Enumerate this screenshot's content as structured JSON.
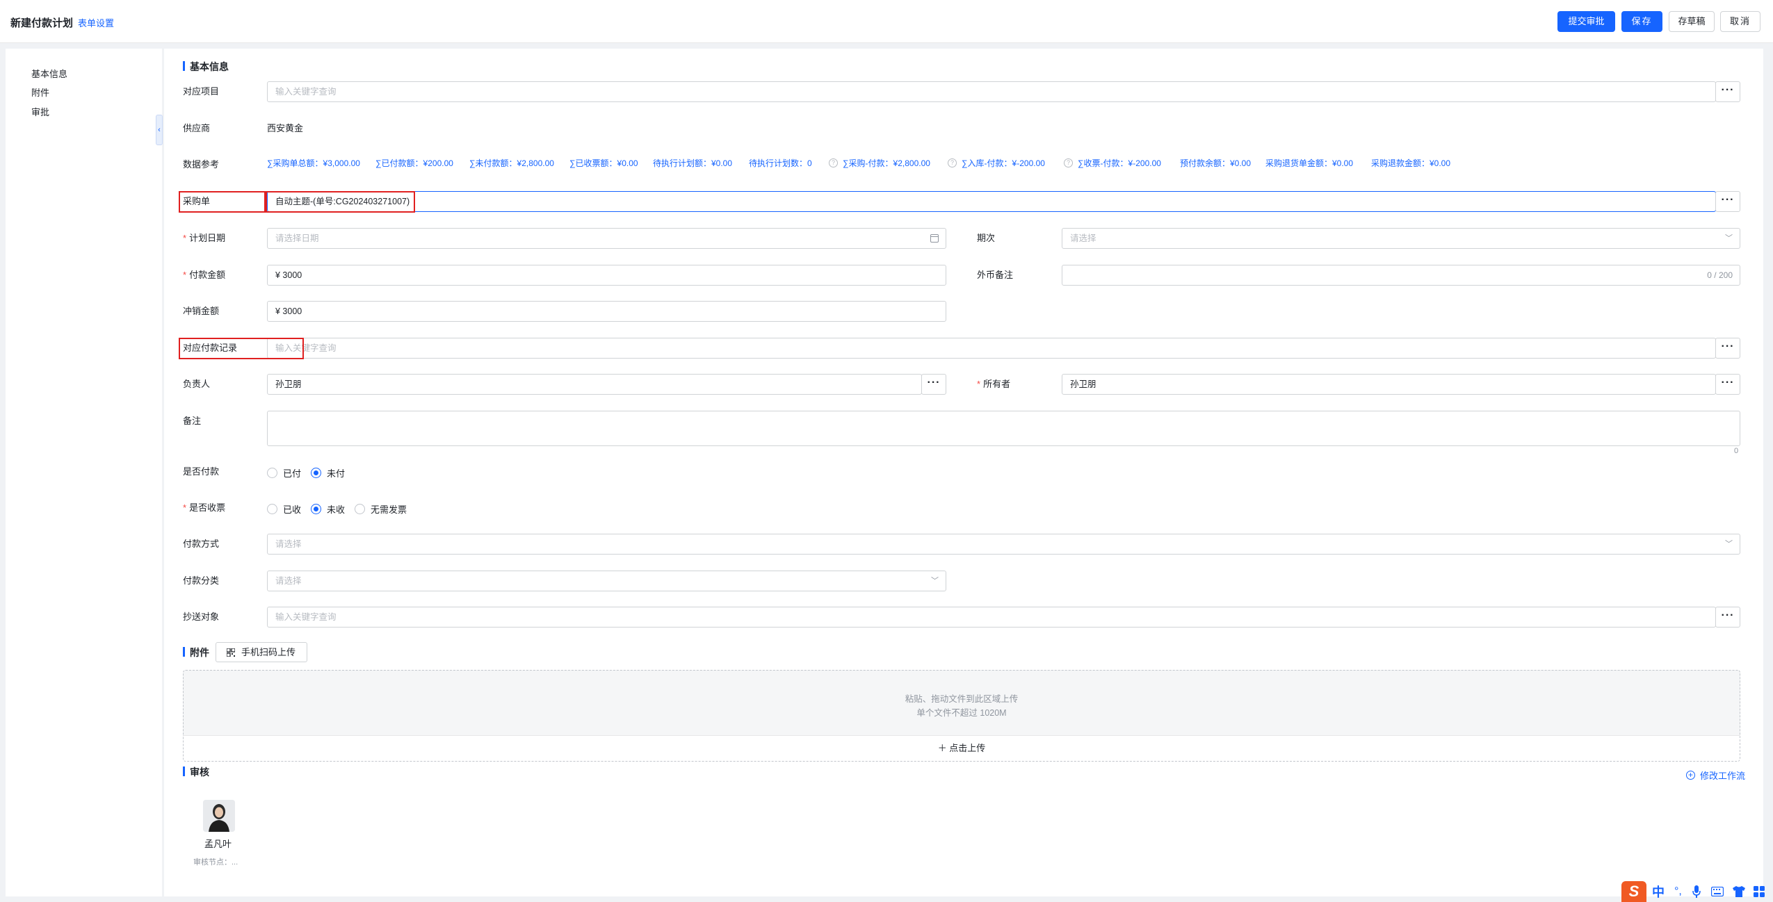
{
  "header": {
    "title": "新建付款计划",
    "form_settings": "表单设置",
    "submit": "提交审批",
    "save": "保存",
    "draft": "存草稿",
    "cancel": "取消"
  },
  "sidebar": {
    "items": [
      {
        "label": "基本信息"
      },
      {
        "label": "附件"
      },
      {
        "label": "审批"
      }
    ]
  },
  "basic": {
    "title": "基本信息",
    "project": {
      "label": "对应项目",
      "placeholder": "输入关键字查询"
    },
    "supplier": {
      "label": "供应商",
      "value": "西安黄金"
    },
    "reference": {
      "label": "数据参考",
      "items": [
        "∑采购单总额：¥3,000.00",
        "∑已付款额：¥200.00",
        "∑未付款额：¥2,800.00",
        "∑已收票额：¥0.00",
        "待执行计划额：¥0.00",
        "待执行计划数：0",
        "∑采购-付款：¥2,800.00",
        "∑入库-付款：¥-200.00",
        "∑收票-付款：¥-200.00",
        "预付款余额：¥0.00",
        "采购退货单金额：¥0.00",
        "采购退款金额：¥0.00"
      ]
    },
    "purchase_order": {
      "label": "采购单",
      "value": "自动主题-(单号:CG202403271007)"
    },
    "plan_date": {
      "label": "计划日期",
      "placeholder": "请选择日期"
    },
    "period": {
      "label": "期次",
      "placeholder": "请选择"
    },
    "amount": {
      "label": "付款金额",
      "value": "¥ 3000"
    },
    "fx_note": {
      "label": "外币备注",
      "counter": "0 / 200"
    },
    "offset": {
      "label": "冲销金额",
      "value": "¥ 3000"
    },
    "payment_record": {
      "label": "对应付款记录",
      "placeholder": "输入关键字查询"
    },
    "owner_person": {
      "label": "负责人",
      "value": "孙卫朋"
    },
    "owner": {
      "label": "所有者",
      "value": "孙卫朋"
    },
    "remark": {
      "label": "备注",
      "counter": "0"
    },
    "paid": {
      "label": "是否付款",
      "options": [
        "已付",
        "未付"
      ]
    },
    "invoice": {
      "label": "是否收票",
      "options": [
        "已收",
        "未收",
        "无需发票"
      ]
    },
    "pay_method": {
      "label": "付款方式",
      "placeholder": "请选择"
    },
    "pay_category": {
      "label": "付款分类",
      "placeholder": "请选择"
    },
    "cc": {
      "label": "抄送对象",
      "placeholder": "输入关键字查询"
    }
  },
  "attachment": {
    "title": "附件",
    "scan": "手机扫码上传",
    "hint1": "粘贴、拖动文件到此区域上传",
    "hint2": "单个文件不超过 1020M",
    "upload": "＋ 点击上传"
  },
  "review": {
    "title": "审核",
    "edit_flow": "修改工作流",
    "approver": "孟凡叶",
    "node": "审核节点：..."
  },
  "ime": {
    "brand": "S",
    "lang": "中"
  },
  "colors": {
    "accent": "#1664ff",
    "required": "#f54a45",
    "highlight": "#e02020"
  },
  "icons": [
    "calendar-icon",
    "chevron-down-icon",
    "more-icon",
    "qr-code-icon",
    "plus-circle-icon",
    "help-icon",
    "collapse-left-icon"
  ]
}
